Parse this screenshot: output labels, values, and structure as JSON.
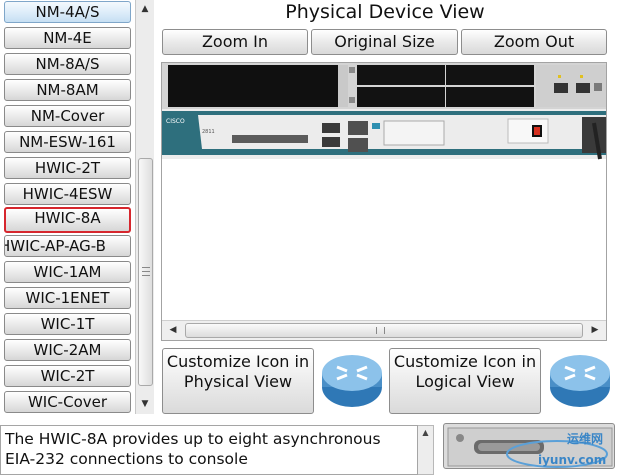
{
  "module_list": {
    "items": [
      {
        "label": "NM-4A/S"
      },
      {
        "label": "NM-4E"
      },
      {
        "label": "NM-8A/S"
      },
      {
        "label": "NM-8AM"
      },
      {
        "label": "NM-Cover"
      },
      {
        "label": "NM-ESW-161"
      },
      {
        "label": "HWIC-2T"
      },
      {
        "label": "HWIC-4ESW"
      },
      {
        "label": "HWIC-8A"
      },
      {
        "label": "HWIC-AP-AG-B"
      },
      {
        "label": "WIC-1AM"
      },
      {
        "label": "WIC-1ENET"
      },
      {
        "label": "WIC-1T"
      },
      {
        "label": "WIC-2AM"
      },
      {
        "label": "WIC-2T"
      },
      {
        "label": "WIC-Cover"
      }
    ],
    "selected_label": "HWIC-8A"
  },
  "physical_view": {
    "title": "Physical Device View",
    "zoom_in_label": "Zoom In",
    "original_size_label": "Original Size",
    "zoom_out_label": "Zoom Out",
    "router_brand": "CISCO",
    "panel_label": "2811"
  },
  "customize": {
    "physical_label": "Customize Icon in Physical View",
    "logical_label": "Customize Icon in Logical View"
  },
  "description": {
    "text": "The HWIC-8A provides up to eight asynchronous EIA-232 connections to console"
  },
  "watermark": {
    "line1": "运维网",
    "line2": "iyunv.com"
  },
  "icons": {
    "router": "router-icon",
    "scroll_up": "arrow-up-icon",
    "scroll_down": "arrow-down-icon",
    "scroll_left": "arrow-left-icon",
    "scroll_right": "arrow-right-icon"
  },
  "colors": {
    "selection_border": "#d6262d",
    "router_blue": "#4a8fc7",
    "chassis_teal": "#2e6f7d"
  }
}
